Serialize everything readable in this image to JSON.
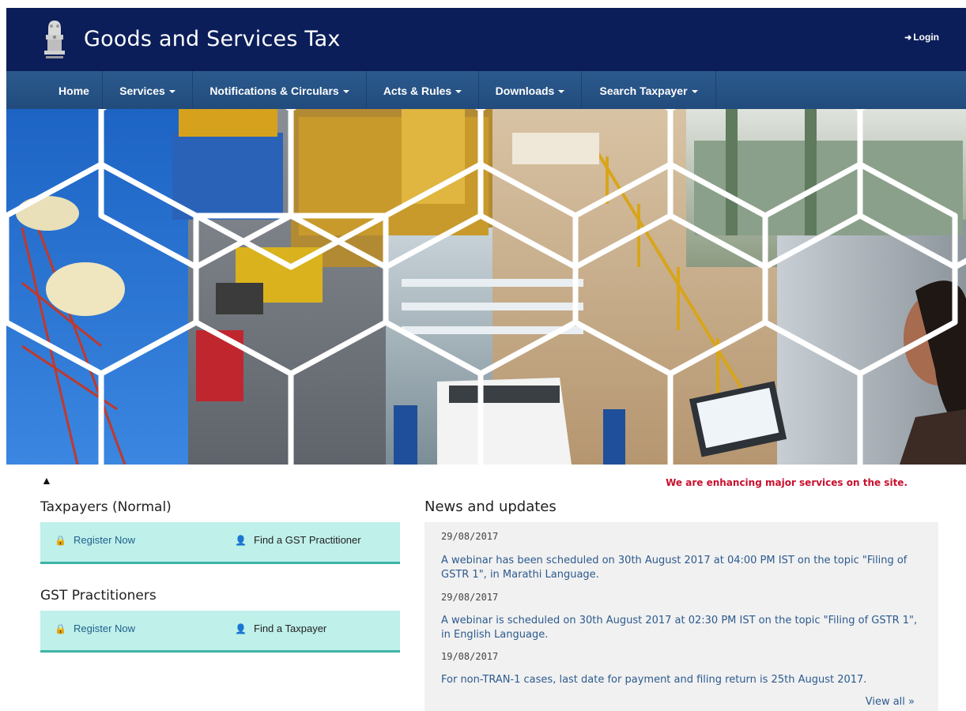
{
  "header": {
    "title": "Goods and Services Tax",
    "login_label": "Login",
    "login_icon": "sign-in-icon",
    "emblem_icon": "national-emblem-icon"
  },
  "nav": {
    "items": [
      {
        "label": "Home",
        "dropdown": false
      },
      {
        "label": "Services",
        "dropdown": true
      },
      {
        "label": "Notifications & Circulars",
        "dropdown": true
      },
      {
        "label": "Acts & Rules",
        "dropdown": true
      },
      {
        "label": "Downloads",
        "dropdown": true
      },
      {
        "label": "Search Taxpayer",
        "dropdown": true
      }
    ]
  },
  "notice": {
    "icon": "bell-icon",
    "text": "We are enhancing major services on the site."
  },
  "taxpayers": {
    "title": "Taxpayers (Normal)",
    "register_label": "Register Now",
    "find_label": "Find a GST Practitioner"
  },
  "practitioners": {
    "title": "GST Practitioners",
    "register_label": "Register Now",
    "find_label": "Find a Taxpayer"
  },
  "news": {
    "title": "News and updates",
    "items": [
      {
        "date": "29/08/2017",
        "text": "A webinar has been scheduled on 30th August 2017 at 04:00 PM IST on the topic \"Filing of GSTR 1\", in Marathi Language."
      },
      {
        "date": "29/08/2017",
        "text": "A webinar is scheduled on 30th August 2017 at 02:30 PM IST on the topic \"Filing of GSTR 1\", in English Language."
      },
      {
        "date": "19/08/2017",
        "text": "For non-TRAN-1 cases, last date for payment and filing return is 25th August 2017."
      }
    ],
    "view_all_label": "View all »"
  },
  "colors": {
    "header_bg": "#0b1e59",
    "nav_bg": "#2c5a8e",
    "panel_bg": "#bff0ea",
    "panel_border": "#3fb3a5",
    "notice_red": "#c8102e",
    "link_blue": "#2c5a8e"
  }
}
